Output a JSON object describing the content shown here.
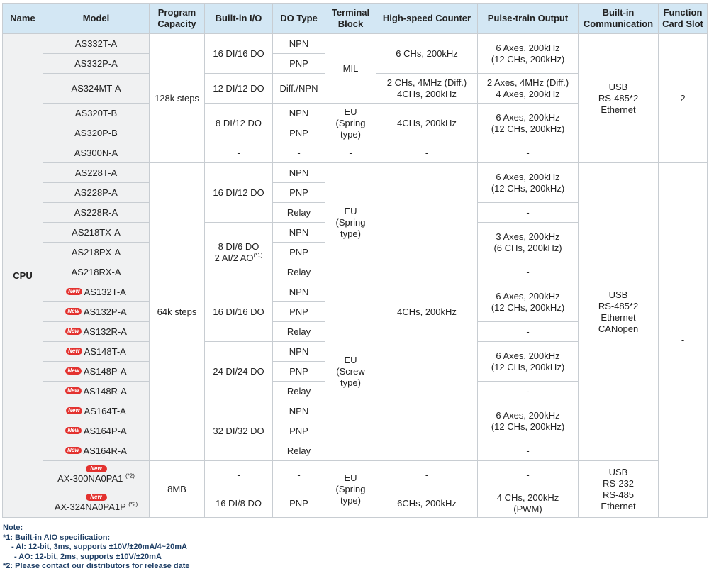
{
  "headers": {
    "name": "Name",
    "model": "Model",
    "program_capacity_1": "Program",
    "program_capacity_2": "Capacity",
    "io": "Built-in I/O",
    "do_type": "DO Type",
    "terminal_1": "Terminal",
    "terminal_2": "Block",
    "hsc": "High-speed Counter",
    "pto": "Pulse-train Output",
    "comm_1": "Built-in",
    "comm_2": "Communication",
    "slot_1": "Function",
    "slot_2": "Card Slot"
  },
  "name_cpu": "CPU",
  "new_badge": "New",
  "models": {
    "m1": "AS332T-A",
    "m2": "AS332P-A",
    "m3": "AS324MT-A",
    "m4": "AS320T-B",
    "m5": "AS320P-B",
    "m6": "AS300N-A",
    "m7": "AS228T-A",
    "m8": "AS228P-A",
    "m9": "AS228R-A",
    "m10": "AS218TX-A",
    "m11": "AS218PX-A",
    "m12": "AS218RX-A",
    "m13": "AS132T-A",
    "m14": "AS132P-A",
    "m15": "AS132R-A",
    "m16": "AS148T-A",
    "m17": "AS148P-A",
    "m18": "AS148R-A",
    "m19": "AS164T-A",
    "m20": "AS164P-A",
    "m21": "AS164R-A",
    "m22": "AX-300NA0PA1",
    "m23": "AX-324NA0PA1P"
  },
  "footnote_2": "(*2)",
  "footnote_1": "(*1)",
  "capacity": {
    "c128k": "128k steps",
    "c64k": "64k steps",
    "c8mb": "8MB"
  },
  "io": {
    "a": "16 DI/16 DO",
    "b": "12 DI/12 DO",
    "c": "8 DI/12 DO",
    "d": "16 DI/12 DO",
    "e1": "8 DI/6 DO",
    "e2": "2 AI/2 AO",
    "f": "16 DI/16 DO",
    "g": "24 DI/24 DO",
    "h": "32 DI/32 DO",
    "j": "16 DI/8 DO"
  },
  "do_types": {
    "npn": "NPN",
    "pnp": "PNP",
    "diff": "Diff./NPN",
    "relay": "Relay"
  },
  "terminal": {
    "mil": "MIL",
    "eu": "EU",
    "spring": "(Spring",
    "screw": "(Screw",
    "type": "type)"
  },
  "hsc": {
    "a": "6 CHs, 200kHz",
    "b1": "2 CHs, 4MHz (Diff.)",
    "b2": "4CHs, 200kHz",
    "c": "4CHs, 200kHz",
    "d": "4CHs, 200kHz",
    "e": "6CHs, 200kHz"
  },
  "pto": {
    "a1": "6 Axes, 200kHz",
    "a2": "(12 CHs, 200kHz)",
    "b1": "2 Axes, 4MHz (Diff.)",
    "b2": "4 Axes, 200kHz",
    "c1": "3 Axes, 200kHz",
    "c2": "(6 CHs, 200kHz)",
    "d1": "4 CHs, 200kHz",
    "d2": "(PWM)"
  },
  "comm": {
    "usb": "USB",
    "rs485x2": "RS-485*2",
    "ethernet": "Ethernet",
    "canopen": "CANopen",
    "rs232": "RS-232",
    "rs485": "RS-485"
  },
  "slot": {
    "two": "2"
  },
  "dash": "-",
  "notes": {
    "title": "Note:",
    "n1": "*1: Built-in AIO specification:",
    "n1a": "- AI: 12-bit, 3ms, supports ±10V/±20mA/4~20mA",
    "n1b": "- AO: 12-bit, 2ms, supports ±10V/±20mA",
    "n2": "*2: Please contact our distributors for release date"
  },
  "colors": {
    "header_bg": "#d3e7f4",
    "model_bg": "#f0f1f2",
    "badge": "#e3322f",
    "note_text": "#1f3f66"
  }
}
